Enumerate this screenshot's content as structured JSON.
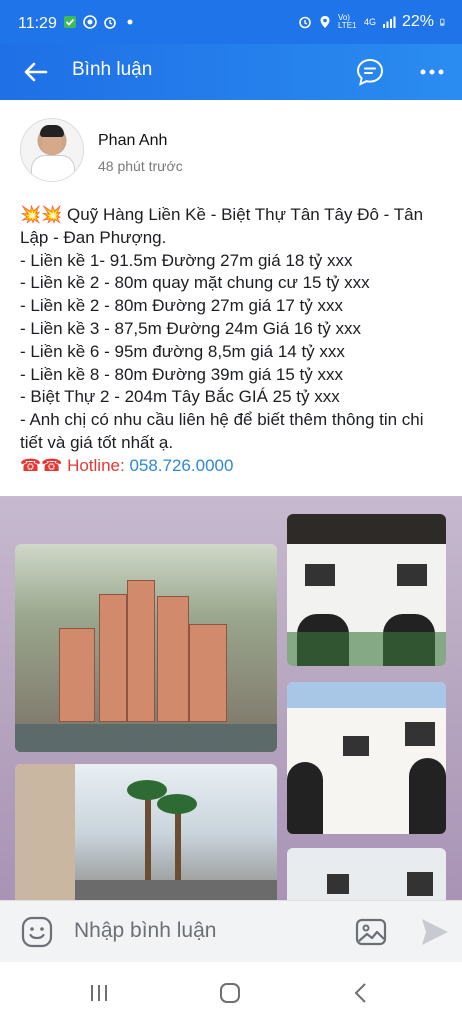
{
  "status_bar": {
    "time": "11:29",
    "battery": "22%",
    "network": "4G",
    "lte": "Vo) LTE1"
  },
  "app_bar": {
    "title": "Bình luận",
    "accent": "#1e74e8"
  },
  "post": {
    "author": "Phan Anh",
    "timestamp": "48 phút trước",
    "lines": [
      "💥💥 Quỹ Hàng Liền Kề - Biệt Thự Tân Tây Đô - Tân Lập - Đan Phượng.",
      "- Liền kề 1- 91.5m Đường 27m giá 18 tỷ xxx",
      "- Liền kề 2 - 80m quay mặt chung cư 15 tỷ xxx",
      "- Liền kề 2 - 80m Đường 27m giá 17 tỷ xxx",
      "- Liền kề 3 - 87,5m Đường 24m Giá 16 tỷ xxx",
      "- Liền kề 6 - 95m đường 8,5m giá 14 tỷ xxx",
      "- Liền kề 8 - 80m Đường 39m giá 15 tỷ xxx",
      "- Biệt Thự 2 - 204m Tây Bắc GIÁ 25 tỷ xxx",
      "- Anh chị có nhu cầu liên hệ để biết thêm thông tin chi tiết và giá tốt nhất ạ."
    ],
    "hotline_prefix": "☎☎ Hotline: ",
    "hotline_number": "058.726.0000",
    "link_color": "#2d88d8"
  },
  "comment_bar": {
    "placeholder": "Nhập bình luận"
  }
}
